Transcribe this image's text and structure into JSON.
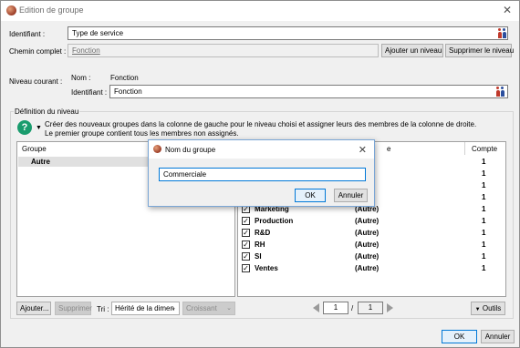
{
  "window": {
    "title": "Edition de groupe",
    "close": "✕"
  },
  "identifiant": {
    "label": "Identifiant :",
    "value": "Type de service"
  },
  "chemin": {
    "label": "Chemin complet :",
    "value": "Fonction",
    "add_level": "Ajouter un niveau",
    "remove_level": "Supprimer le niveau"
  },
  "niveau": {
    "label": "Niveau courant :",
    "nom_label": "Nom :",
    "nom_value": "Fonction",
    "id_label": "Identifiant :",
    "id_value": "Fonction"
  },
  "definition": {
    "legend": "Définition du niveau",
    "help_line1": "Créer des nouveaux groupes dans la colonne de gauche pour le niveau choisi et assigner leurs des membres de la colonne de droite.",
    "help_line2": "Le premier groupe contient tous les membres non assignés."
  },
  "left_panel": {
    "header": "Groupe",
    "rows": [
      {
        "label": "Autre"
      }
    ]
  },
  "right_panel": {
    "header_tail": "e",
    "count_header": "Compte",
    "rows": [
      {
        "name": "",
        "group": "e)",
        "count": "1",
        "checked": false
      },
      {
        "name": "",
        "group": "e)",
        "count": "1",
        "checked": false
      },
      {
        "name": "",
        "group": "e)",
        "count": "1",
        "checked": false
      },
      {
        "name": "",
        "group": "e)",
        "count": "1",
        "checked": false
      },
      {
        "name": "Marketing",
        "group": "(Autre)",
        "count": "1",
        "checked": true
      },
      {
        "name": "Production",
        "group": "(Autre)",
        "count": "1",
        "checked": true
      },
      {
        "name": "R&D",
        "group": "(Autre)",
        "count": "1",
        "checked": true
      },
      {
        "name": "RH",
        "group": "(Autre)",
        "count": "1",
        "checked": true
      },
      {
        "name": "SI",
        "group": "(Autre)",
        "count": "1",
        "checked": true
      },
      {
        "name": "Ventes",
        "group": "(Autre)",
        "count": "1",
        "checked": true
      }
    ]
  },
  "bottom_toolbar": {
    "add": "Ajouter...",
    "delete": "Supprimer",
    "sort_label": "Tri :",
    "sort_value": "Hérité de la dimen",
    "order_value": "Croissant",
    "page_current": "1",
    "page_sep": "/",
    "page_total": "1",
    "tools": "Outils"
  },
  "footer": {
    "ok": "OK",
    "cancel": "Annuler"
  },
  "dialog": {
    "title": "Nom du groupe",
    "close": "✕",
    "input_value": "Commerciale",
    "ok": "OK",
    "cancel": "Annuler"
  }
}
